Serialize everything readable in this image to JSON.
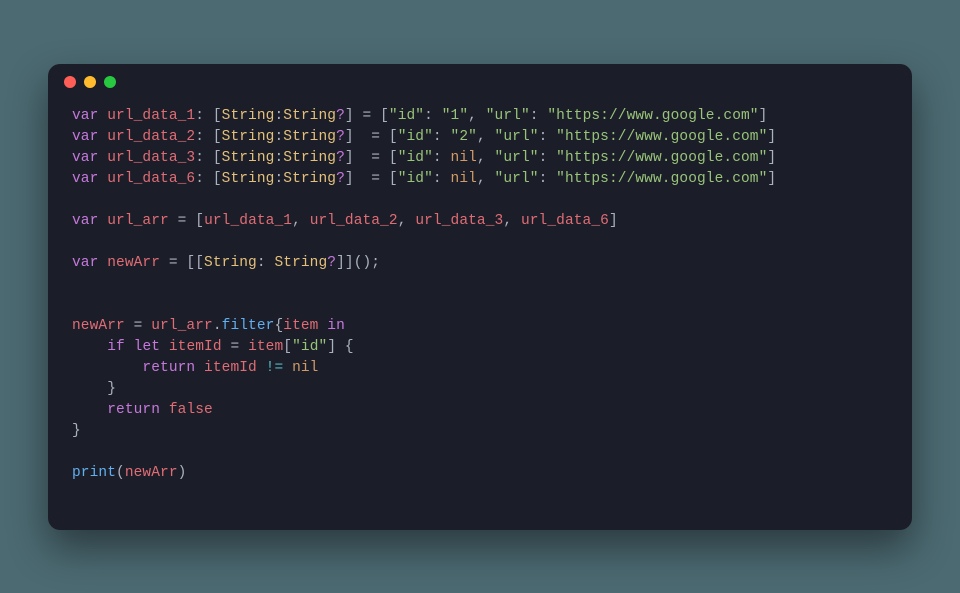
{
  "window": {
    "title": ""
  },
  "traffic": {
    "red": "close",
    "yellow": "minimize",
    "green": "zoom"
  },
  "code": {
    "l01": {
      "kw": "var",
      "name": "url_data_1",
      "type_open": ": [",
      "t1": "String",
      "colon": ":",
      "t2": "String",
      "opt": "?",
      "type_close": "] = [",
      "k1": "\"id\"",
      "sep1": ": ",
      "v1": "\"1\"",
      "comma": ", ",
      "k2": "\"url\"",
      "sep2": ": ",
      "v2": "\"https://www.google.com\"",
      "close": "]"
    },
    "l02": {
      "kw": "var",
      "name": "url_data_2",
      "type_open": ": [",
      "t1": "String",
      "colon": ":",
      "t2": "String",
      "opt": "?",
      "type_close": "]  = [",
      "k1": "\"id\"",
      "sep1": ": ",
      "v1": "\"2\"",
      "comma": ", ",
      "k2": "\"url\"",
      "sep2": ": ",
      "v2": "\"https://www.google.com\"",
      "close": "]"
    },
    "l03": {
      "kw": "var",
      "name": "url_data_3",
      "type_open": ": [",
      "t1": "String",
      "colon": ":",
      "t2": "String",
      "opt": "?",
      "type_close": "]  = [",
      "k1": "\"id\"",
      "sep1": ": ",
      "v1": "nil",
      "comma": ", ",
      "k2": "\"url\"",
      "sep2": ": ",
      "v2": "\"https://www.google.com\"",
      "close": "]"
    },
    "l04": {
      "kw": "var",
      "name": "url_data_6",
      "type_open": ": [",
      "t1": "String",
      "colon": ":",
      "t2": "String",
      "opt": "?",
      "type_close": "]  = [",
      "k1": "\"id\"",
      "sep1": ": ",
      "v1": "nil",
      "comma": ", ",
      "k2": "\"url\"",
      "sep2": ": ",
      "v2": "\"https://www.google.com\"",
      "close": "]"
    },
    "l06": {
      "kw": "var",
      "name": "url_arr",
      "eq": " = [",
      "a": "url_data_1",
      "c1": ", ",
      "b": "url_data_2",
      "c2": ", ",
      "c": "url_data_3",
      "c3": ", ",
      "d": "url_data_6",
      "close": "]"
    },
    "l08": {
      "kw": "var",
      "name": "newArr",
      "eq": " = [[",
      "t1": "String",
      "colon": ": ",
      "t2": "String",
      "opt": "?",
      "close": "]]();"
    },
    "l11": {
      "lhs": "newArr",
      "eq": " = ",
      "rhs": "url_arr",
      "dot": ".",
      "fn": "filter",
      "brace": "{",
      "item": "item",
      "in": " in"
    },
    "l12": {
      "indent": "    ",
      "if": "if",
      "sp": " ",
      "let": "let",
      "name": " itemId",
      "eq": " = ",
      "item": "item",
      "br": "[",
      "key": "\"id\"",
      "br2": "] {"
    },
    "l13": {
      "indent": "        ",
      "ret": "return",
      "name": " itemId ",
      "op": "!=",
      "sp": " ",
      "nil": "nil"
    },
    "l14": {
      "indent": "    ",
      "brace": "}"
    },
    "l15": {
      "indent": "    ",
      "ret": "return",
      "sp": " ",
      "val": "false"
    },
    "l16": {
      "brace": "}"
    },
    "l18": {
      "fn": "print",
      "open": "(",
      "arg": "newArr",
      "close": ")"
    }
  }
}
